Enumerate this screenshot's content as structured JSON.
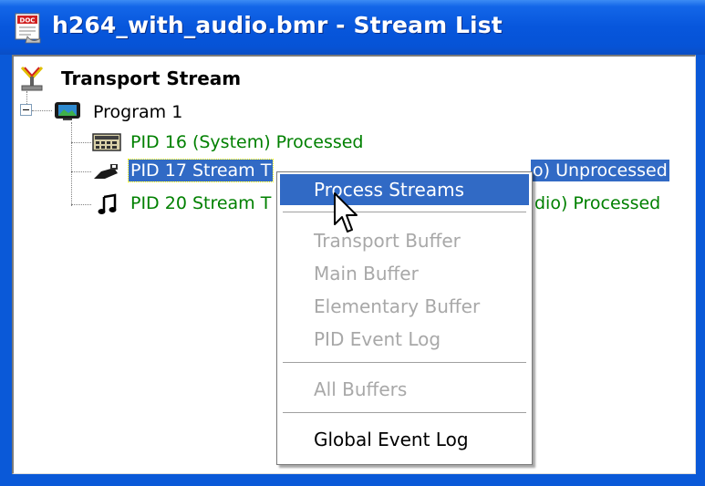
{
  "window": {
    "title": "h264_with_audio.bmr - Stream List",
    "title_icon": "doc-window-icon"
  },
  "tree": {
    "root": {
      "label": "Transport Stream",
      "icon": "transport-stream-icon"
    },
    "program": {
      "label": "Program 1",
      "icon": "program-monitor-icon",
      "expanded": true
    },
    "streams": [
      {
        "label": "PID 16 (System) Processed",
        "icon": "system-table-icon",
        "color": "#008000",
        "selected": false
      },
      {
        "label": "PID 17 Stream T",
        "label_tail": "o) Unprocessed",
        "icon": "video-camera-icon",
        "color": "#000000",
        "selected": true
      },
      {
        "label": "PID 20 Stream T",
        "label_tail": "dio) Processed",
        "icon": "music-note-icon",
        "color": "#008000",
        "selected": false
      }
    ]
  },
  "context_menu": {
    "items": [
      {
        "label": "Process Streams",
        "state": "highlighted"
      },
      {
        "label": "Transport Buffer",
        "state": "disabled"
      },
      {
        "label": "Main Buffer",
        "state": "disabled"
      },
      {
        "label": "Elementary Buffer",
        "state": "disabled"
      },
      {
        "label": "PID Event Log",
        "state": "disabled"
      },
      {
        "label": "All Buffers",
        "state": "disabled"
      },
      {
        "label": "Global Event Log",
        "state": "enabled"
      }
    ]
  },
  "colors": {
    "titlebar": "#0756dc",
    "selection": "#316ac5",
    "processed_text": "#008000",
    "disabled_text": "#a8a8a8"
  }
}
